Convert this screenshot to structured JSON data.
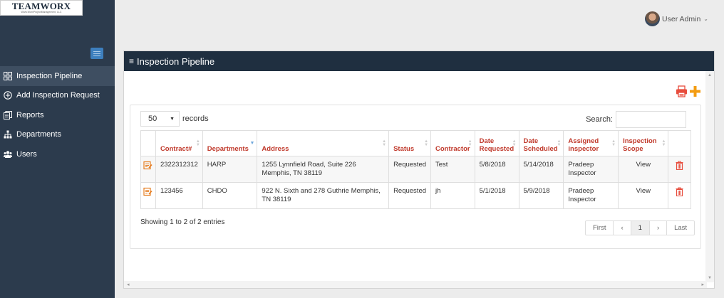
{
  "logo": {
    "brand": "TEAMWORX",
    "tagline": "Www.WorxProjectManagement, LLC"
  },
  "sidebar": {
    "items": [
      {
        "label": "Inspection Pipeline",
        "icon": "grid-icon",
        "active": true
      },
      {
        "label": "Add Inspection Request",
        "icon": "plus-circle-icon",
        "active": false
      },
      {
        "label": "Reports",
        "icon": "reports-icon",
        "active": false
      },
      {
        "label": "Departments",
        "icon": "sitemap-icon",
        "active": false
      },
      {
        "label": "Users",
        "icon": "users-icon",
        "active": false
      }
    ]
  },
  "topbar": {
    "user_name": "User Admin"
  },
  "panel": {
    "title": "Inspection Pipeline",
    "length_value": "50",
    "length_suffix": "records",
    "search_label": "Search:",
    "search_value": "",
    "columns": [
      "Contract#",
      "Departments",
      "Address",
      "Status",
      "Contractor",
      "Date Requested",
      "Date Scheduled",
      "Assigned inspector",
      "Inspection Scope"
    ],
    "rows": [
      {
        "contract": "2322312312",
        "department": "HARP",
        "address": "1255 Lynnfield Road, Suite 226 Memphis, TN 38119",
        "status": "Requested",
        "contractor": "Test",
        "date_requested": "5/8/2018",
        "date_scheduled": "5/14/2018",
        "inspector": "Pradeep Inspector",
        "scope": "View"
      },
      {
        "contract": "123456",
        "department": "CHDO",
        "address": "922 N. Sixth and 278 Guthrie Memphis, TN 38119",
        "status": "Requested",
        "contractor": "jh",
        "date_requested": "5/1/2018",
        "date_scheduled": "5/9/2018",
        "inspector": "Pradeep Inspector",
        "scope": "View"
      }
    ],
    "info": "Showing 1 to 2 of 2 entries",
    "pager": {
      "first": "First",
      "prev": "‹",
      "current": "1",
      "next": "›",
      "last": "Last"
    }
  },
  "colors": {
    "sidebar_bg": "#2c3b4d",
    "header_bg": "#1f2f40",
    "accent_red": "#c0392b",
    "accent_orange": "#f39c12"
  }
}
